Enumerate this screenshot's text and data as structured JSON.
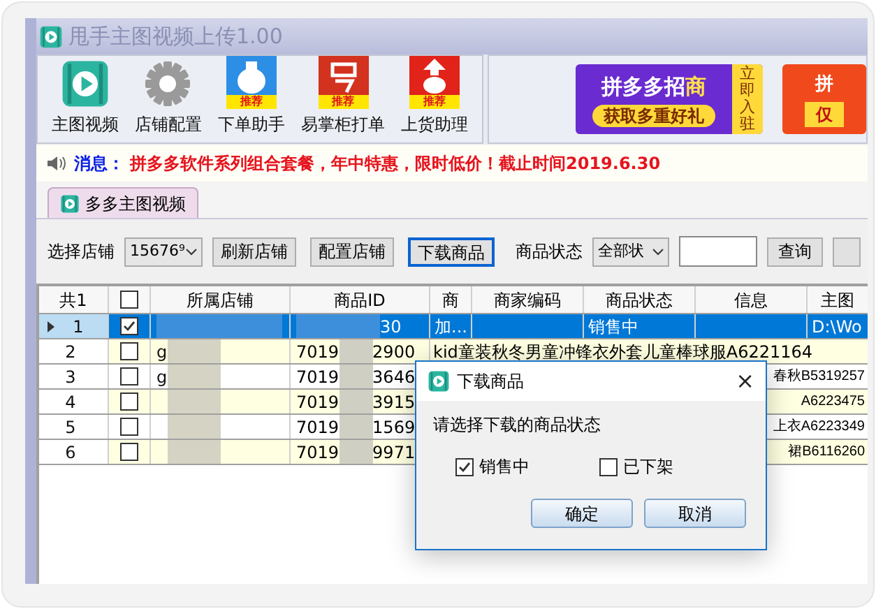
{
  "window": {
    "title": "甩手主图视频上传1.00"
  },
  "toolbar": {
    "items": [
      {
        "kind": "video",
        "label": "主图视频"
      },
      {
        "kind": "gear",
        "label": "店铺配置"
      },
      {
        "kind": "bag",
        "label": "下单助手",
        "badge": "推荐"
      },
      {
        "kind": "yi",
        "label": "易掌柜打单",
        "badge": "推荐"
      },
      {
        "kind": "upload",
        "label": "上货助理",
        "badge": "推荐"
      }
    ]
  },
  "ads": [
    {
      "kind": "purple",
      "headline": "拼多多招",
      "highlight": "商",
      "subline": "获取多重好礼",
      "side": "立即入驻"
    },
    {
      "kind": "orange",
      "headline": "拼",
      "subline": "仅"
    }
  ],
  "message": {
    "label": "消息：",
    "text": "拼多多软件系列组合套餐，年中特惠，限时低价！截止时间2019.6.30"
  },
  "tabs": [
    {
      "label": "多多主图视频",
      "selected": true
    }
  ],
  "filter": {
    "shop_label": "选择店铺",
    "shop_value": "15676⁹",
    "buttons": [
      {
        "label": "刷新店铺",
        "focused": false
      },
      {
        "label": "配置店铺",
        "focused": false
      },
      {
        "label": "下载商品",
        "focused": true
      }
    ],
    "status_label": "商品状态",
    "status_value": "全部状",
    "query_button": "查询"
  },
  "table": {
    "select_all_checked": false,
    "columns": [
      "共1",
      "",
      "所属店铺",
      "商品ID",
      "商",
      "商家编码",
      "商品状态",
      "信息",
      "主图"
    ],
    "rows": [
      {
        "index": "1",
        "checked": true,
        "selected": true,
        "store": "",
        "id_start": "",
        "id_end": "30",
        "col_shang": "加...",
        "status": "销售中",
        "info": "",
        "path": "D:\\Wo"
      },
      {
        "index": "2",
        "checked": false,
        "selected": false,
        "store": "g",
        "id_start": "7019",
        "id_end": "2900",
        "col_shang": "",
        "status": "",
        "info": "kid童装秋冬男童冲锋衣外套儿童棒球服A6221164",
        "path": ""
      },
      {
        "index": "3",
        "checked": false,
        "selected": false,
        "store": "g",
        "id_start": "7019",
        "id_end": "3646",
        "col_shang": "",
        "status": "",
        "info": "春秋B5319257",
        "path": ""
      },
      {
        "index": "4",
        "checked": false,
        "selected": false,
        "store": "",
        "id_start": "7019",
        "id_end": "3915",
        "col_shang": "",
        "status": "",
        "info": "A6223475",
        "path": ""
      },
      {
        "index": "5",
        "checked": false,
        "selected": false,
        "store": "",
        "id_start": "7019",
        "id_end": "1569",
        "col_shang": "",
        "status": "",
        "info": "上衣A6223349",
        "path": ""
      },
      {
        "index": "6",
        "checked": false,
        "selected": false,
        "store": "",
        "id_start": "7019",
        "id_end": "9971",
        "col_shang": "",
        "status": "",
        "info": "裙B6116260",
        "path": ""
      }
    ]
  },
  "dialog": {
    "title": "下载商品",
    "close": "×",
    "prompt": "请选择下载的商品状态",
    "options": [
      {
        "label": "销售中",
        "checked": true
      },
      {
        "label": "已下架",
        "checked": false
      }
    ],
    "buttons": [
      "确定",
      "取消"
    ]
  }
}
